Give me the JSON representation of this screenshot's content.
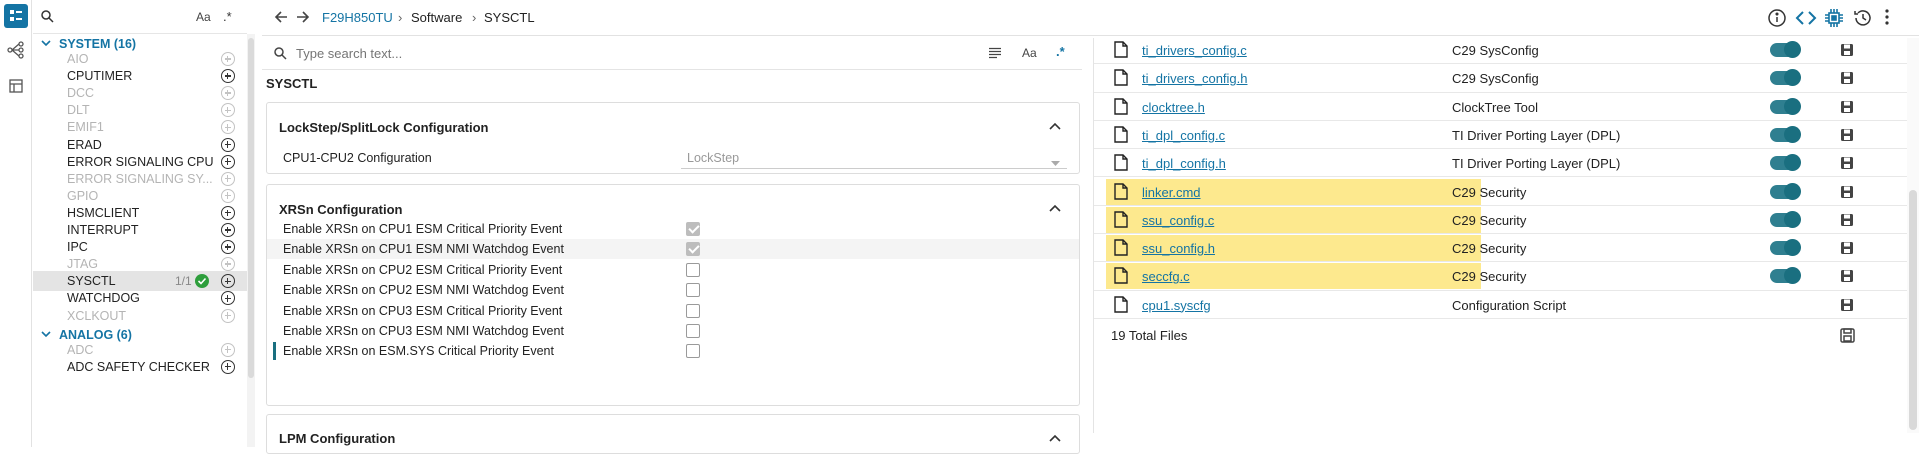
{
  "sidebar": {
    "search_placeholder": "",
    "case_btn": "Aa",
    "categories": [
      {
        "label": "SYSTEM (16)"
      },
      {
        "label": "ANALOG (6)"
      }
    ],
    "items": [
      {
        "label": "AIO",
        "disabled": true
      },
      {
        "label": "CPUTIMER",
        "disabled": false
      },
      {
        "label": "DCC",
        "disabled": true
      },
      {
        "label": "DLT",
        "disabled": true
      },
      {
        "label": "EMIF1",
        "disabled": true
      },
      {
        "label": "ERAD",
        "disabled": false
      },
      {
        "label": "ERROR SIGNALING CPU",
        "disabled": false
      },
      {
        "label": "ERROR SIGNALING SY...",
        "disabled": true
      },
      {
        "label": "GPIO",
        "disabled": true
      },
      {
        "label": "HSMCLIENT",
        "disabled": false
      },
      {
        "label": "INTERRUPT",
        "disabled": false
      },
      {
        "label": "IPC",
        "disabled": false
      },
      {
        "label": "JTAG",
        "disabled": true
      },
      {
        "label": "SYSCTL",
        "disabled": false,
        "count": "1/1"
      },
      {
        "label": "WATCHDOG",
        "disabled": false
      },
      {
        "label": "XCLKOUT",
        "disabled": true
      }
    ],
    "analog_items": [
      {
        "label": "ADC",
        "disabled": true
      },
      {
        "label": "ADC SAFETY CHECKER",
        "disabled": false
      }
    ]
  },
  "breadcrumb": {
    "device": "F29H850TU",
    "sep": "›",
    "section": "Software",
    "current": "SYSCTL"
  },
  "search": {
    "placeholder": "Type search text...",
    "case_btn": "Aa"
  },
  "module_title": "SYSCTL",
  "panels": {
    "lockstep": {
      "title": "LockStep/SplitLock Configuration",
      "row_label": "CPU1-CPU2 Configuration",
      "select_value": "LockStep"
    },
    "xrsn": {
      "title": "XRSn Configuration",
      "rows": [
        {
          "label": "Enable XRSn on CPU1 ESM Critical Priority Event",
          "checked": true
        },
        {
          "label": "Enable XRSn on CPU1 ESM NMI Watchdog Event",
          "checked": true
        },
        {
          "label": "Enable XRSn on CPU2 ESM Critical Priority Event",
          "checked": false
        },
        {
          "label": "Enable XRSn on CPU2 ESM NMI Watchdog Event",
          "checked": false
        },
        {
          "label": "Enable XRSn on CPU3 ESM Critical Priority Event",
          "checked": false
        },
        {
          "label": "Enable XRSn on CPU3 ESM NMI Watchdog Event",
          "checked": false
        },
        {
          "label": "Enable XRSn on ESM.SYS Critical Priority Event",
          "checked": false
        }
      ]
    },
    "lpm": {
      "title": "LPM Configuration"
    }
  },
  "files": {
    "rows": [
      {
        "name": "ti_drivers_config.c",
        "generator": "C29 SysConfig",
        "toggle": true,
        "highlight": false
      },
      {
        "name": "ti_drivers_config.h",
        "generator": "C29 SysConfig",
        "toggle": true,
        "highlight": false
      },
      {
        "name": "clocktree.h",
        "generator": "ClockTree Tool",
        "toggle": true,
        "highlight": false
      },
      {
        "name": "ti_dpl_config.c",
        "generator": "TI Driver Porting Layer (DPL)",
        "toggle": true,
        "highlight": false
      },
      {
        "name": "ti_dpl_config.h",
        "generator": "TI Driver Porting Layer (DPL)",
        "toggle": true,
        "highlight": false
      },
      {
        "name": "linker.cmd",
        "generator": "C29 Security",
        "toggle": true,
        "highlight": true
      },
      {
        "name": "ssu_config.c",
        "generator": "C29 Security",
        "toggle": true,
        "highlight": true
      },
      {
        "name": "ssu_config.h",
        "generator": "C29 Security",
        "toggle": true,
        "highlight": true
      },
      {
        "name": "seccfg.c",
        "generator": "C29 Security",
        "toggle": true,
        "highlight": true
      },
      {
        "name": "cpu1.syscfg",
        "generator": "Configuration Script",
        "toggle": false,
        "highlight": false
      }
    ],
    "total": "19 Total Files"
  },
  "colors": {
    "accent": "#1474a4",
    "toggle": "#2f7f90",
    "highlight": "#fde57a",
    "ok": "#2e9e3c"
  }
}
